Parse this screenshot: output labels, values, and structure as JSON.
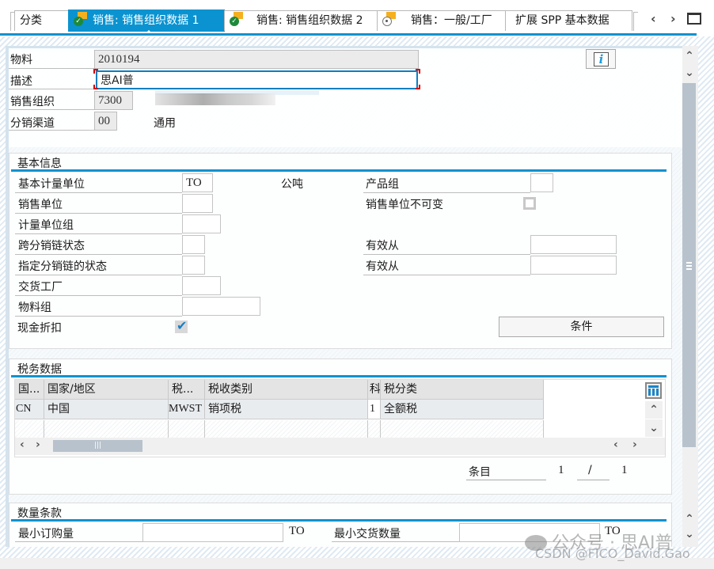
{
  "tabs": [
    {
      "label": "分类",
      "icon": "none",
      "active": false
    },
    {
      "label": "销售: 销售组织数据 1",
      "icon": "check-flag-icon",
      "active": true
    },
    {
      "label": "销售: 销售组织数据 2",
      "icon": "check-flag-icon",
      "active": false
    },
    {
      "label": "销售：一般/工厂",
      "icon": "pending-flag-icon",
      "active": false
    },
    {
      "label": "扩展 SPP 基本数据",
      "icon": "none",
      "active": false
    }
  ],
  "tab_nav": {
    "prev": "‹",
    "next": "›"
  },
  "header": {
    "material_label": "物料",
    "material_value": "2010194",
    "description_label": "描述",
    "description_value": "思AI普",
    "sales_org_label": "销售组织",
    "sales_org_value": "7300",
    "dist_channel_label": "分销渠道",
    "dist_channel_value": "00",
    "dist_channel_text": "通用",
    "info_button": "i"
  },
  "basic_info": {
    "title": "基本信息",
    "base_uom_label": "基本计量单位",
    "base_uom_value": "TO",
    "base_uom_text": "公吨",
    "sales_unit_label": "销售单位",
    "sales_unit_value": "",
    "uom_group_label": "计量单位组",
    "uom_group_value": "",
    "x_dchain_status_label": "跨分销链状态",
    "x_dchain_status_value": "",
    "dchain_status_label": "指定分销链的状态",
    "dchain_status_value": "",
    "delivering_plant_label": "交货工厂",
    "delivering_plant_value": "",
    "material_group_label": "物料组",
    "material_group_value": "",
    "cash_discount_label": "现金折扣",
    "cash_discount_checked": true,
    "division_label": "产品组",
    "division_value": "",
    "sales_unit_fixed_label": "销售单位不可变",
    "sales_unit_fixed_checked": false,
    "valid_from_1_label": "有效从",
    "valid_from_1_value": "",
    "valid_from_2_label": "有效从",
    "valid_from_2_value": "",
    "conditions_button": "条件"
  },
  "tax_data": {
    "title": "税务数据",
    "columns": [
      "国...",
      "国家/地区",
      "税...",
      "税收类别",
      "科",
      "税分类"
    ],
    "rows": [
      [
        "CN",
        "中国",
        "MWST",
        "销项税",
        "1",
        "全额税"
      ]
    ],
    "entry_label": "条目",
    "entry_current": "1",
    "entry_sep": "/",
    "entry_total": "1"
  },
  "quantity": {
    "title": "数量条款",
    "min_order_label": "最小订购量",
    "min_order_value": "",
    "min_order_unit": "TO",
    "min_delivery_label": "最小交货数量",
    "min_delivery_value": "",
    "min_delivery_unit": "TO"
  },
  "watermark": {
    "line1": "公众号 · 思AI普",
    "line2": "CSDN @FICO_David.Gao"
  }
}
